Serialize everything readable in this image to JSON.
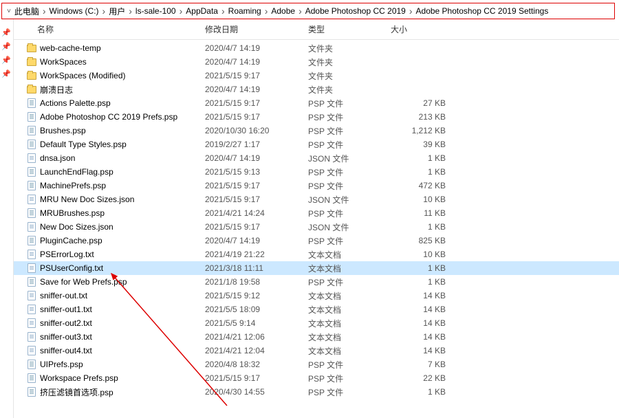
{
  "breadcrumbs": [
    {
      "label": "此电脑"
    },
    {
      "label": "Windows (C:)"
    },
    {
      "label": "用户"
    },
    {
      "label": "ls-sale-100"
    },
    {
      "label": "AppData"
    },
    {
      "label": "Roaming"
    },
    {
      "label": "Adobe"
    },
    {
      "label": "Adobe Photoshop CC 2019"
    },
    {
      "label": "Adobe Photoshop CC 2019 Settings"
    }
  ],
  "columns": {
    "name": "名称",
    "modified": "修改日期",
    "type": "类型",
    "size": "大小"
  },
  "files": [
    {
      "icon": "folder",
      "name": "web-cache-temp",
      "date": "2020/4/7 14:19",
      "type": "文件夹",
      "size": ""
    },
    {
      "icon": "folder",
      "name": "WorkSpaces",
      "date": "2020/4/7 14:19",
      "type": "文件夹",
      "size": ""
    },
    {
      "icon": "folder",
      "name": "WorkSpaces (Modified)",
      "date": "2021/5/15 9:17",
      "type": "文件夹",
      "size": ""
    },
    {
      "icon": "folder",
      "name": "崩溃日志",
      "date": "2020/4/7 14:19",
      "type": "文件夹",
      "size": ""
    },
    {
      "icon": "psp",
      "name": "Actions Palette.psp",
      "date": "2021/5/15 9:17",
      "type": "PSP 文件",
      "size": "27 KB"
    },
    {
      "icon": "psp",
      "name": "Adobe Photoshop CC 2019 Prefs.psp",
      "date": "2021/5/15 9:17",
      "type": "PSP 文件",
      "size": "213 KB"
    },
    {
      "icon": "psp",
      "name": "Brushes.psp",
      "date": "2020/10/30 16:20",
      "type": "PSP 文件",
      "size": "1,212 KB"
    },
    {
      "icon": "psp",
      "name": "Default Type Styles.psp",
      "date": "2019/2/27 1:17",
      "type": "PSP 文件",
      "size": "39 KB"
    },
    {
      "icon": "file",
      "name": "dnsa.json",
      "date": "2020/4/7 14:19",
      "type": "JSON 文件",
      "size": "1 KB"
    },
    {
      "icon": "psp",
      "name": "LaunchEndFlag.psp",
      "date": "2021/5/15 9:13",
      "type": "PSP 文件",
      "size": "1 KB"
    },
    {
      "icon": "psp",
      "name": "MachinePrefs.psp",
      "date": "2021/5/15 9:17",
      "type": "PSP 文件",
      "size": "472 KB"
    },
    {
      "icon": "file",
      "name": "MRU New Doc Sizes.json",
      "date": "2021/5/15 9:17",
      "type": "JSON 文件",
      "size": "10 KB"
    },
    {
      "icon": "psp",
      "name": "MRUBrushes.psp",
      "date": "2021/4/21 14:24",
      "type": "PSP 文件",
      "size": "11 KB"
    },
    {
      "icon": "file",
      "name": "New Doc Sizes.json",
      "date": "2021/5/15 9:17",
      "type": "JSON 文件",
      "size": "1 KB"
    },
    {
      "icon": "psp",
      "name": "PluginCache.psp",
      "date": "2020/4/7 14:19",
      "type": "PSP 文件",
      "size": "825 KB"
    },
    {
      "icon": "file",
      "name": "PSErrorLog.txt",
      "date": "2021/4/19 21:22",
      "type": "文本文档",
      "size": "10 KB"
    },
    {
      "icon": "file",
      "name": "PSUserConfig.txt",
      "date": "2021/3/18 11:11",
      "type": "文本文档",
      "size": "1 KB",
      "selected": true
    },
    {
      "icon": "psp",
      "name": "Save for Web Prefs.psp",
      "date": "2021/1/8 19:58",
      "type": "PSP 文件",
      "size": "1 KB"
    },
    {
      "icon": "file",
      "name": "sniffer-out.txt",
      "date": "2021/5/15 9:12",
      "type": "文本文档",
      "size": "14 KB"
    },
    {
      "icon": "file",
      "name": "sniffer-out1.txt",
      "date": "2021/5/5 18:09",
      "type": "文本文档",
      "size": "14 KB"
    },
    {
      "icon": "file",
      "name": "sniffer-out2.txt",
      "date": "2021/5/5 9:14",
      "type": "文本文档",
      "size": "14 KB"
    },
    {
      "icon": "file",
      "name": "sniffer-out3.txt",
      "date": "2021/4/21 12:06",
      "type": "文本文档",
      "size": "14 KB"
    },
    {
      "icon": "file",
      "name": "sniffer-out4.txt",
      "date": "2021/4/21 12:04",
      "type": "文本文档",
      "size": "14 KB"
    },
    {
      "icon": "psp",
      "name": "UIPrefs.psp",
      "date": "2020/4/8 18:32",
      "type": "PSP 文件",
      "size": "7 KB"
    },
    {
      "icon": "psp",
      "name": "Workspace Prefs.psp",
      "date": "2021/5/15 9:17",
      "type": "PSP 文件",
      "size": "22 KB"
    },
    {
      "icon": "psp",
      "name": "挤压滤镜首选项.psp",
      "date": "2020/4/30 14:55",
      "type": "PSP 文件",
      "size": "1 KB"
    }
  ],
  "annotation": {
    "arrow_color": "#d00"
  }
}
